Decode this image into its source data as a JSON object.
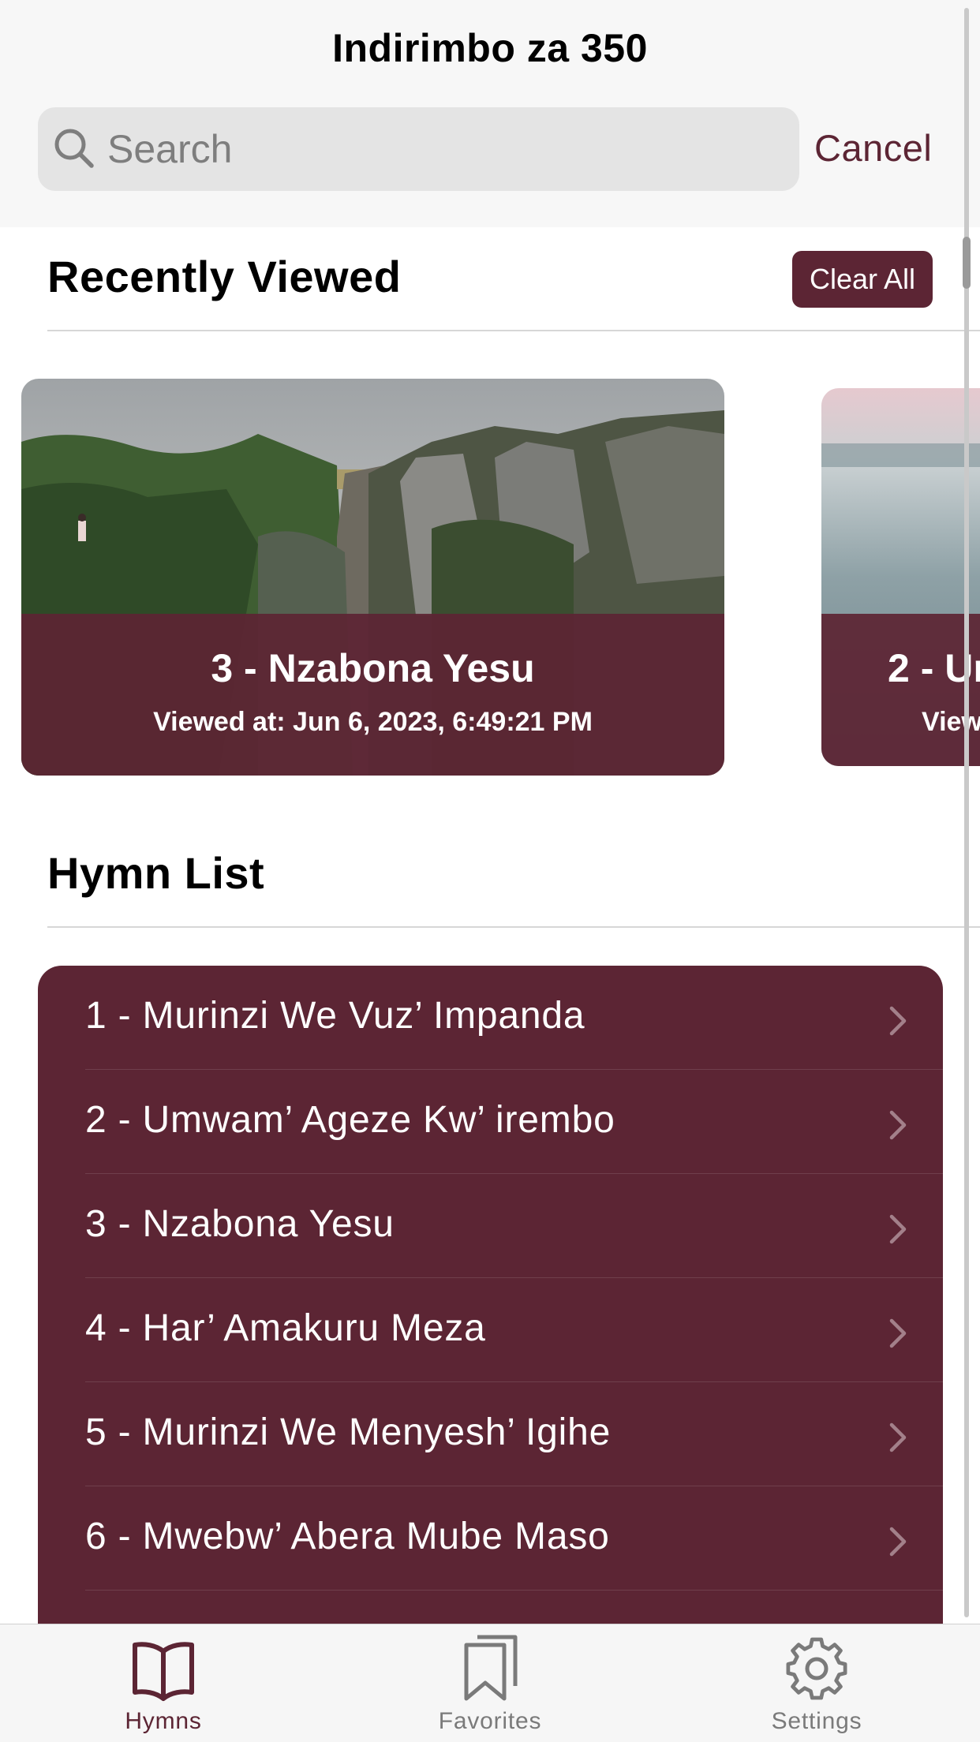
{
  "app": {
    "title": "Indirimbo za 350"
  },
  "search": {
    "placeholder": "Search",
    "value": "",
    "cancel_label": "Cancel"
  },
  "recent": {
    "heading": "Recently Viewed",
    "clear_label": "Clear All",
    "cards": [
      {
        "title": "3 - Nzabona Yesu",
        "viewed": "Viewed at: Jun 6, 2023, 6:49:21 PM"
      },
      {
        "title": "2 - Ur",
        "viewed": "View"
      }
    ]
  },
  "hymns": {
    "heading": "Hymn List",
    "items": [
      "1 - Murinzi We Vuz’ Impanda",
      "2 - Umwam’ Ageze Kw’ irembo",
      "3 - Nzabona Yesu",
      "4 - Har’ Amakuru Meza",
      "5 - Murinzi We Menyesh’ Igihe",
      "6 - Mwebw’ Abera Mube Maso"
    ]
  },
  "tabs": [
    {
      "label": "Hymns",
      "icon": "book-icon",
      "active": true
    },
    {
      "label": "Favorites",
      "icon": "bookmark-icon",
      "active": false
    },
    {
      "label": "Settings",
      "icon": "gear-icon",
      "active": false
    }
  ],
  "colors": {
    "accent": "#5c2534",
    "header_bg": "#f7f7f7",
    "search_bg": "#e4e4e4",
    "inactive_tab": "#7a7a7a"
  }
}
